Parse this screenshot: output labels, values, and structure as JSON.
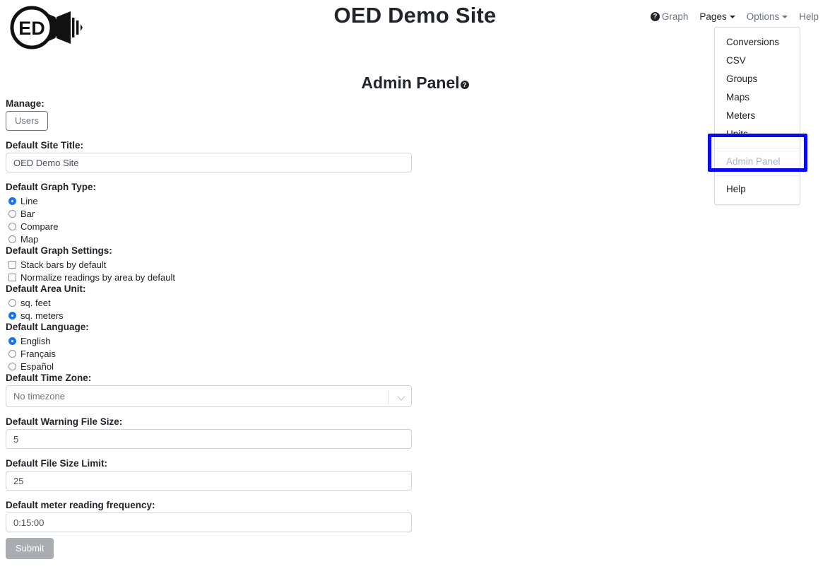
{
  "logo": {
    "name": "oed-logo",
    "text": "ED"
  },
  "header": {
    "site_title": "OED Demo Site",
    "panel_title": "Admin Panel",
    "panel_help_icon": "help-circle-icon"
  },
  "topnav": {
    "help_icon": "help-circle-icon",
    "items": [
      {
        "label": "Graph",
        "active": false,
        "caret": false
      },
      {
        "label": "Pages",
        "active": true,
        "caret": true
      },
      {
        "label": "Options",
        "active": false,
        "caret": true
      },
      {
        "label": "Help",
        "active": false,
        "caret": false
      }
    ]
  },
  "dropdown": {
    "open_for": "Pages",
    "items": [
      {
        "label": "Conversions",
        "disabled": false,
        "divider_before": false
      },
      {
        "label": "CSV",
        "disabled": false,
        "divider_before": false
      },
      {
        "label": "Groups",
        "disabled": false,
        "divider_before": false
      },
      {
        "label": "Maps",
        "disabled": false,
        "divider_before": false
      },
      {
        "label": "Meters",
        "disabled": false,
        "divider_before": false
      },
      {
        "label": "Units",
        "disabled": false,
        "divider_before": false
      },
      {
        "label": "Admin Panel",
        "disabled": true,
        "divider_before": true
      },
      {
        "label": "Help",
        "disabled": false,
        "divider_before": true
      }
    ]
  },
  "highlight": {
    "color": "#0a0af0",
    "target": "Admin Panel"
  },
  "form": {
    "manage_label": "Manage:",
    "users_button": "Users",
    "site_title_label": "Default Site Title:",
    "site_title_value": "OED Demo Site",
    "graph_type_label": "Default Graph Type:",
    "graph_type_options": [
      {
        "label": "Line",
        "selected": true
      },
      {
        "label": "Bar",
        "selected": false
      },
      {
        "label": "Compare",
        "selected": false
      },
      {
        "label": "Map",
        "selected": false
      }
    ],
    "graph_settings_label": "Default Graph Settings:",
    "graph_settings_options": [
      {
        "label": "Stack bars by default",
        "checked": false
      },
      {
        "label": "Normalize readings by area by default",
        "checked": false
      }
    ],
    "area_unit_label": "Default Area Unit:",
    "area_unit_options": [
      {
        "label": "sq. feet",
        "selected": false
      },
      {
        "label": "sq. meters",
        "selected": true
      }
    ],
    "language_label": "Default Language:",
    "language_options": [
      {
        "label": "English",
        "selected": true
      },
      {
        "label": "Français",
        "selected": false
      },
      {
        "label": "Español",
        "selected": false
      }
    ],
    "timezone_label": "Default Time Zone:",
    "timezone_value": "No timezone",
    "warning_file_size_label": "Default Warning File Size:",
    "warning_file_size_value": "5",
    "file_size_limit_label": "Default File Size Limit:",
    "file_size_limit_value": "25",
    "meter_frequency_label": "Default meter reading frequency:",
    "meter_frequency_value": "0:15:00",
    "submit_button": "Submit"
  }
}
